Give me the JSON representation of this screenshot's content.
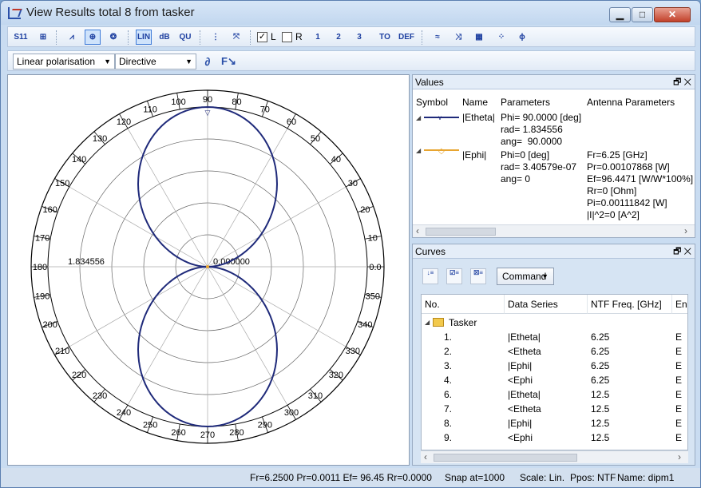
{
  "window": {
    "title": "View Results total 8 from tasker"
  },
  "toolbar1": {
    "tools": [
      "S11",
      "",
      "",
      "",
      "",
      "LIN",
      "dB",
      "QU",
      "",
      "",
      "",
      "",
      "",
      "",
      "",
      "",
      "",
      "",
      "",
      ""
    ],
    "check_l_label": "L",
    "check_r_label": "R",
    "num1": "1",
    "num2": "2",
    "num3": "3",
    "to_label": "TO",
    "def_label": "DEF"
  },
  "toolbar2": {
    "polarisation": "Linear polarisation",
    "mode": "Directive"
  },
  "plot": {
    "angle_labels": [
      "0.0",
      "10",
      "20",
      "30",
      "40",
      "50",
      "60",
      "70",
      "80",
      "90",
      "100",
      "110",
      "120",
      "130",
      "140",
      "150",
      "160",
      "170",
      "180",
      "190",
      "200",
      "210",
      "220",
      "230",
      "240",
      "250",
      "260",
      "270",
      "280",
      "290",
      "300",
      "310",
      "320",
      "330",
      "340",
      "350"
    ],
    "radius_max_label": "1.834556",
    "radius_center_label": "0.000000",
    "line_color": "#1f2a7a"
  },
  "values_pane": {
    "title": "Values",
    "headers": {
      "symbol": "Symbol",
      "name": "Name",
      "parameters": "Parameters",
      "antenna": "Antenna Parameters"
    },
    "rows": [
      {
        "name": "|Etheta|",
        "color": "#1f2a7a",
        "params": [
          "Phi= 90.0000 [deg]",
          "rad= 1.834556",
          "ang=  90.0000"
        ],
        "antenna": []
      },
      {
        "name": "|Ephi|",
        "color": "#e8a530",
        "params": [
          "Phi=0 [deg]",
          "rad= 3.40579e-07",
          "ang= 0"
        ],
        "antenna": [
          "Fr=6.25 [GHz]",
          "Pr=0.00107868 [W]",
          "Ef=96.4471 [W/W*100%]",
          "Rr=0 [Ohm]",
          "Pi=0.00111842 [W]",
          "|I|^2=0 [A^2]"
        ]
      }
    ]
  },
  "curves_pane": {
    "title": "Curves",
    "command_label": "Command",
    "headers": [
      "No.",
      "Data Series",
      "NTF Freq. [GHz]",
      "Ena"
    ],
    "group": "Tasker",
    "rows": [
      {
        "no": "1.",
        "series": "|Etheta|",
        "freq": "6.25",
        "ena": "E"
      },
      {
        "no": "2.",
        "series": "<Etheta",
        "freq": "6.25",
        "ena": "E"
      },
      {
        "no": "3.",
        "series": "|Ephi|",
        "freq": "6.25",
        "ena": "E"
      },
      {
        "no": "4.",
        "series": "<Ephi",
        "freq": "6.25",
        "ena": "E"
      },
      {
        "no": "6.",
        "series": "|Etheta|",
        "freq": "12.5",
        "ena": "E"
      },
      {
        "no": "7.",
        "series": "<Etheta",
        "freq": "12.5",
        "ena": "E"
      },
      {
        "no": "8.",
        "series": "|Ephi|",
        "freq": "12.5",
        "ena": "E"
      },
      {
        "no": "9.",
        "series": "<Ephi",
        "freq": "12.5",
        "ena": "E"
      }
    ]
  },
  "status": {
    "readout": "Fr=6.2500 Pr=0.0011 Ef= 96.45 Rr=0.0000",
    "snap": "Snap at=1000",
    "scale": "Scale: Lin.",
    "ppos": "Ppos: NTF",
    "name": "Name: dipm1"
  }
}
